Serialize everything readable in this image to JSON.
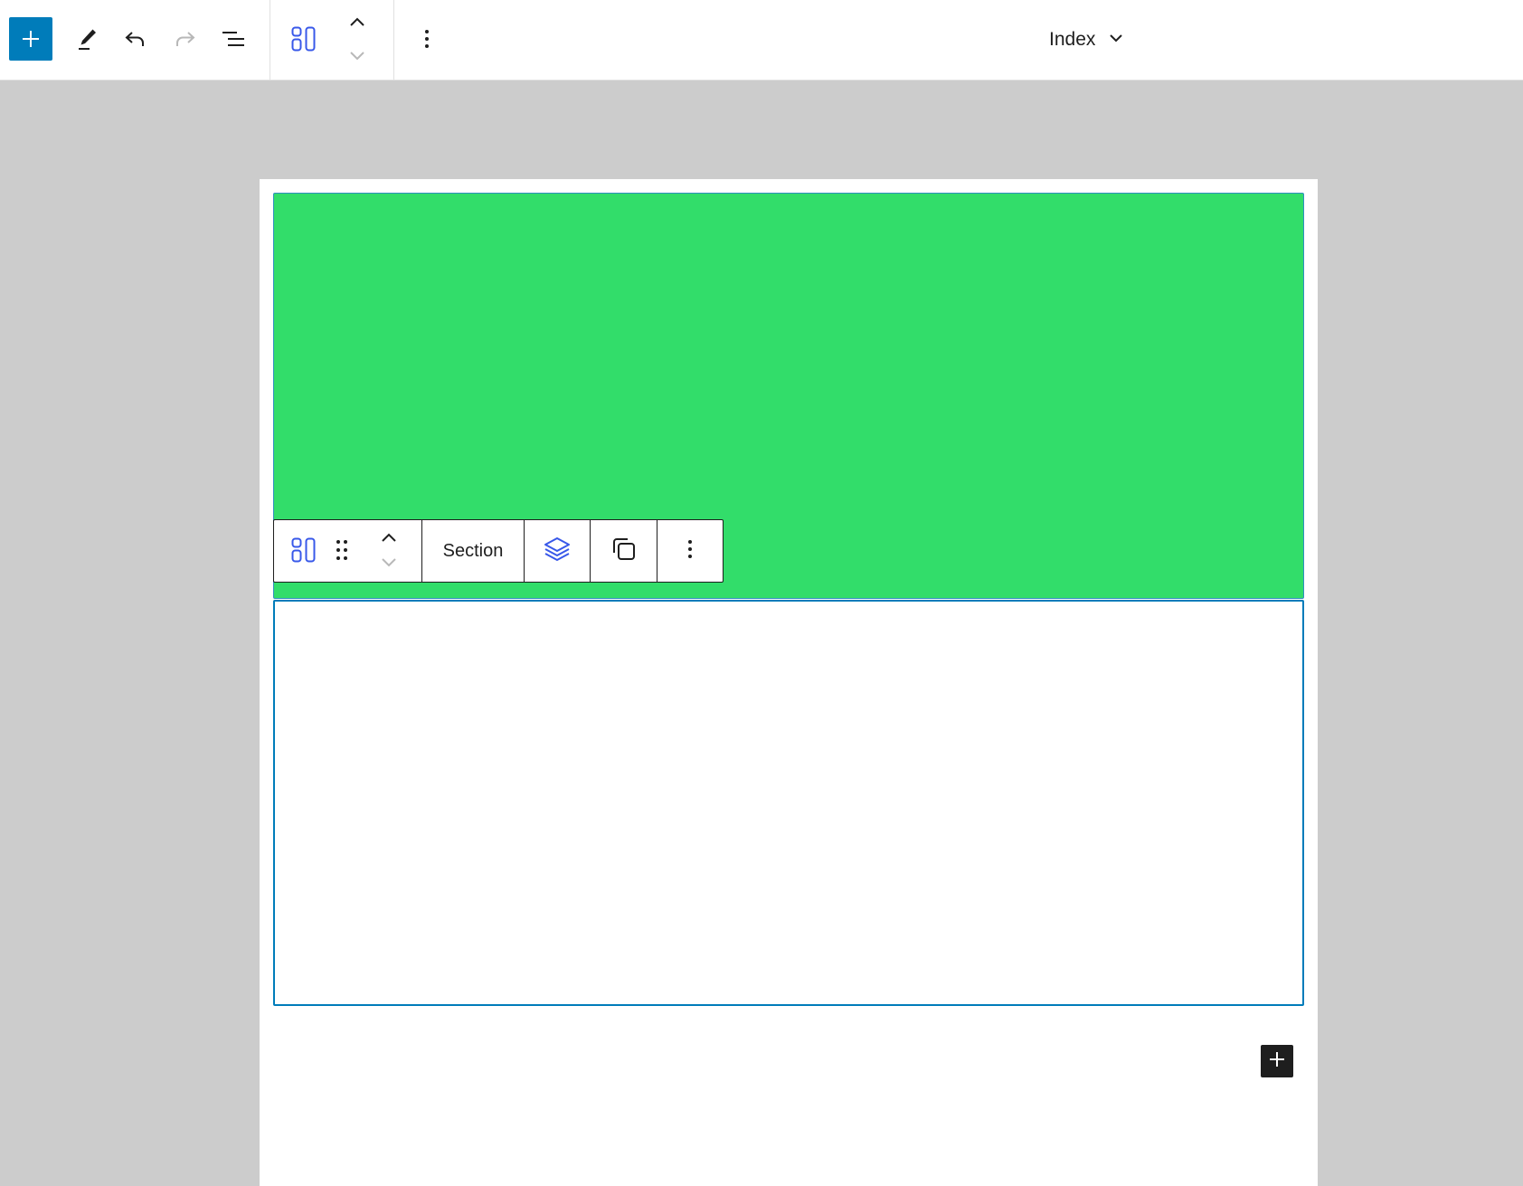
{
  "header": {
    "inserter_icon": "plus-icon",
    "tools_icon": "pencil-icon",
    "undo_icon": "undo-icon",
    "redo_icon": "redo-icon",
    "list_view_icon": "list-view-icon",
    "block_type_icon": "layout-icon",
    "move_up_icon": "chevron-up-icon",
    "move_down_icon": "chevron-down-icon",
    "more_icon": "more-vertical-icon",
    "document_title": "Index",
    "document_title_icon": "chevron-down-icon"
  },
  "block_toolbar": {
    "block_type_icon": "layout-icon",
    "drag_icon": "drag-handle-icon",
    "move_up_icon": "chevron-up-icon",
    "move_down_icon": "chevron-down-icon",
    "label": "Section",
    "layers_icon": "layers-icon",
    "duplicate_icon": "duplicate-icon",
    "options_icon": "more-vertical-icon"
  },
  "canvas": {
    "appender_icon": "plus-icon"
  },
  "colors": {
    "accent": "#007cba",
    "section_background": "#32dd6a",
    "canvas_background": "#cccccc",
    "icon_dark": "#1e1e1e",
    "icon_blue": "#3858e9",
    "icon_disabled": "#b8b8b8"
  }
}
